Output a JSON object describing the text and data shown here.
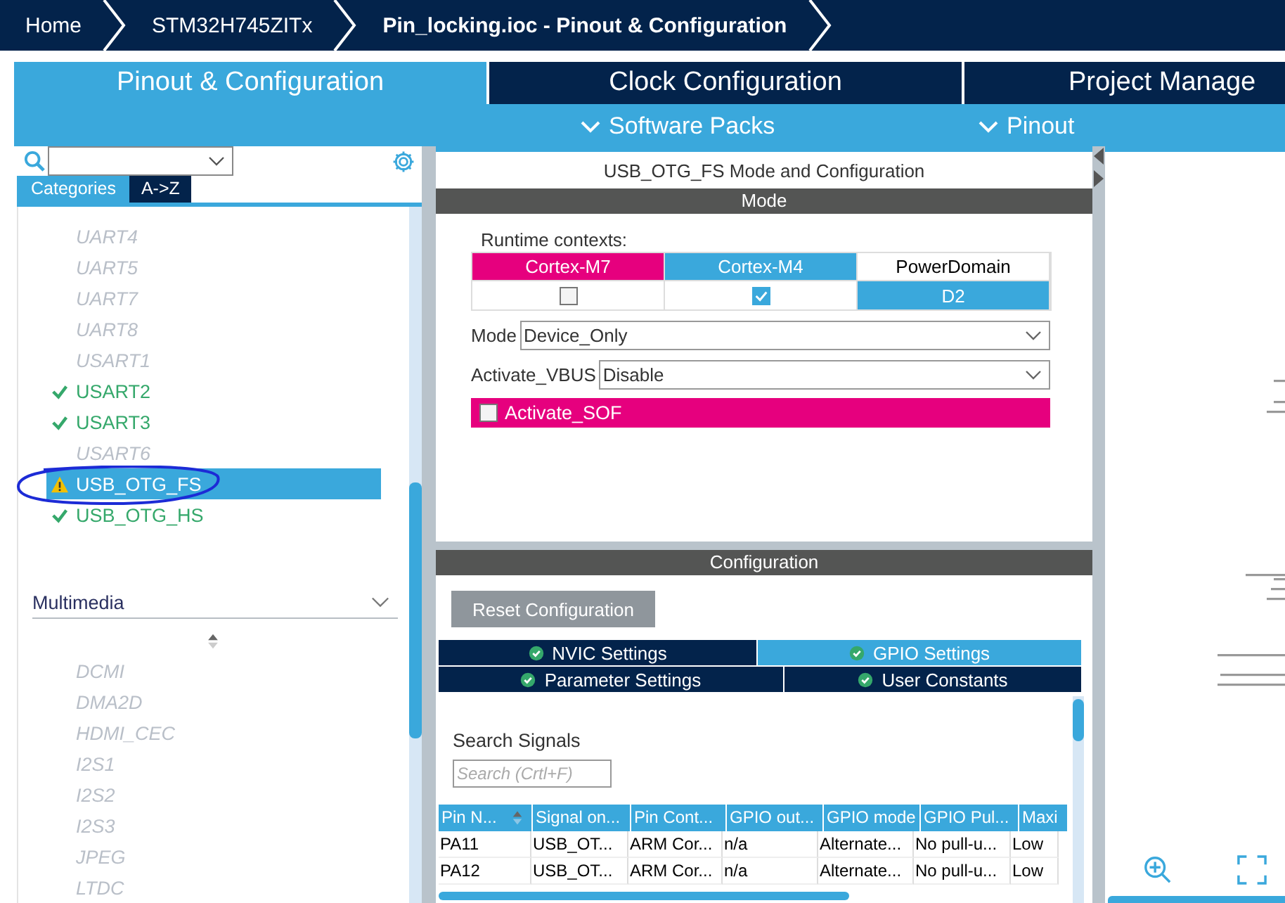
{
  "breadcrumb": [
    {
      "label": "Home",
      "current": false
    },
    {
      "label": "STM32H745ZITx",
      "current": false
    },
    {
      "label": "Pin_locking.ioc - Pinout & Configuration",
      "current": true
    }
  ],
  "main_tabs": [
    {
      "label": "Pinout & Configuration",
      "selected": true
    },
    {
      "label": "Clock Configuration",
      "selected": false
    },
    {
      "label": "Project Manage",
      "selected": false
    }
  ],
  "sub_menus": [
    "Software Packs",
    "Pinout"
  ],
  "sidebar": {
    "view_tabs": [
      {
        "label": "Categories",
        "selected": true
      },
      {
        "label": "A->Z",
        "selected": false
      }
    ],
    "items": [
      {
        "label": "UART4",
        "kind": "disabled",
        "selected": false
      },
      {
        "label": "UART5",
        "kind": "disabled",
        "selected": false
      },
      {
        "label": "UART7",
        "kind": "disabled",
        "selected": false
      },
      {
        "label": "UART8",
        "kind": "disabled",
        "selected": false
      },
      {
        "label": "USART1",
        "kind": "disabled",
        "selected": false
      },
      {
        "label": "USART2",
        "kind": "ok",
        "selected": false
      },
      {
        "label": "USART3",
        "kind": "ok",
        "selected": false
      },
      {
        "label": "USART6",
        "kind": "disabled",
        "selected": false
      },
      {
        "label": "USB_OTG_FS",
        "kind": "warning",
        "selected": true
      },
      {
        "label": "USB_OTG_HS",
        "kind": "ok",
        "selected": false
      }
    ],
    "sections": [
      {
        "title": "Multimedia",
        "expanded": true,
        "items": [
          {
            "label": "DCMI",
            "kind": "disabled",
            "selected": false
          },
          {
            "label": "DMA2D",
            "kind": "disabled",
            "selected": false
          },
          {
            "label": "HDMI_CEC",
            "kind": "disabled",
            "selected": false
          },
          {
            "label": "I2S1",
            "kind": "disabled",
            "selected": false
          },
          {
            "label": "I2S2",
            "kind": "disabled",
            "selected": false
          },
          {
            "label": "I2S3",
            "kind": "disabled",
            "selected": false
          },
          {
            "label": "JPEG",
            "kind": "disabled",
            "selected": false
          },
          {
            "label": "LTDC",
            "kind": "disabled",
            "selected": false
          }
        ]
      }
    ]
  },
  "mode_panel": {
    "title": "USB_OTG_FS Mode and Configuration",
    "header": "Mode",
    "runtime_label": "Runtime contexts:",
    "contexts": [
      {
        "name": "Cortex-M7",
        "color": "#e6007e",
        "checked": false
      },
      {
        "name": "Cortex-M4",
        "color": "#3aa8dc",
        "checked": true
      }
    ],
    "power_domain": {
      "label": "PowerDomain",
      "value": "D2"
    },
    "fields": [
      {
        "label": "Mode",
        "value": "Device_Only"
      },
      {
        "label": "Activate_VBUS",
        "value": "Disable"
      }
    ],
    "options": [
      {
        "label": "Activate_SOF",
        "checked": false
      }
    ]
  },
  "config_panel": {
    "header": "Configuration",
    "reset_button": "Reset Configuration",
    "tab_rows": [
      {
        "tabs": [
          {
            "label": "NVIC Settings",
            "selected": false
          },
          {
            "label": "GPIO Settings",
            "selected": true
          }
        ]
      },
      {
        "tabs": [
          {
            "label": "Parameter Settings",
            "selected": false
          },
          {
            "label": "User Constants",
            "selected": false
          }
        ]
      }
    ],
    "search_label": "Search Signals",
    "search": {
      "placeholder": "Search (Crtl+F)"
    },
    "table": {
      "columns": [
        {
          "label": "Pin N...",
          "sorted": true
        },
        {
          "label": "Signal on...",
          "sorted": false
        },
        {
          "label": "Pin Cont...",
          "sorted": false
        },
        {
          "label": "GPIO out...",
          "sorted": false
        },
        {
          "label": "GPIO mode",
          "sorted": false
        },
        {
          "label": "GPIO Pul...",
          "sorted": false
        },
        {
          "label": "Maxi",
          "sorted": false
        }
      ],
      "rows": [
        [
          "PA11",
          "USB_OT...",
          "ARM Cor...",
          "n/a",
          "Alternate...",
          "No pull-u...",
          "Low"
        ],
        [
          "PA12",
          "USB_OT...",
          "ARM Cor...",
          "n/a",
          "Alternate...",
          "No pull-u...",
          "Low"
        ]
      ]
    }
  }
}
